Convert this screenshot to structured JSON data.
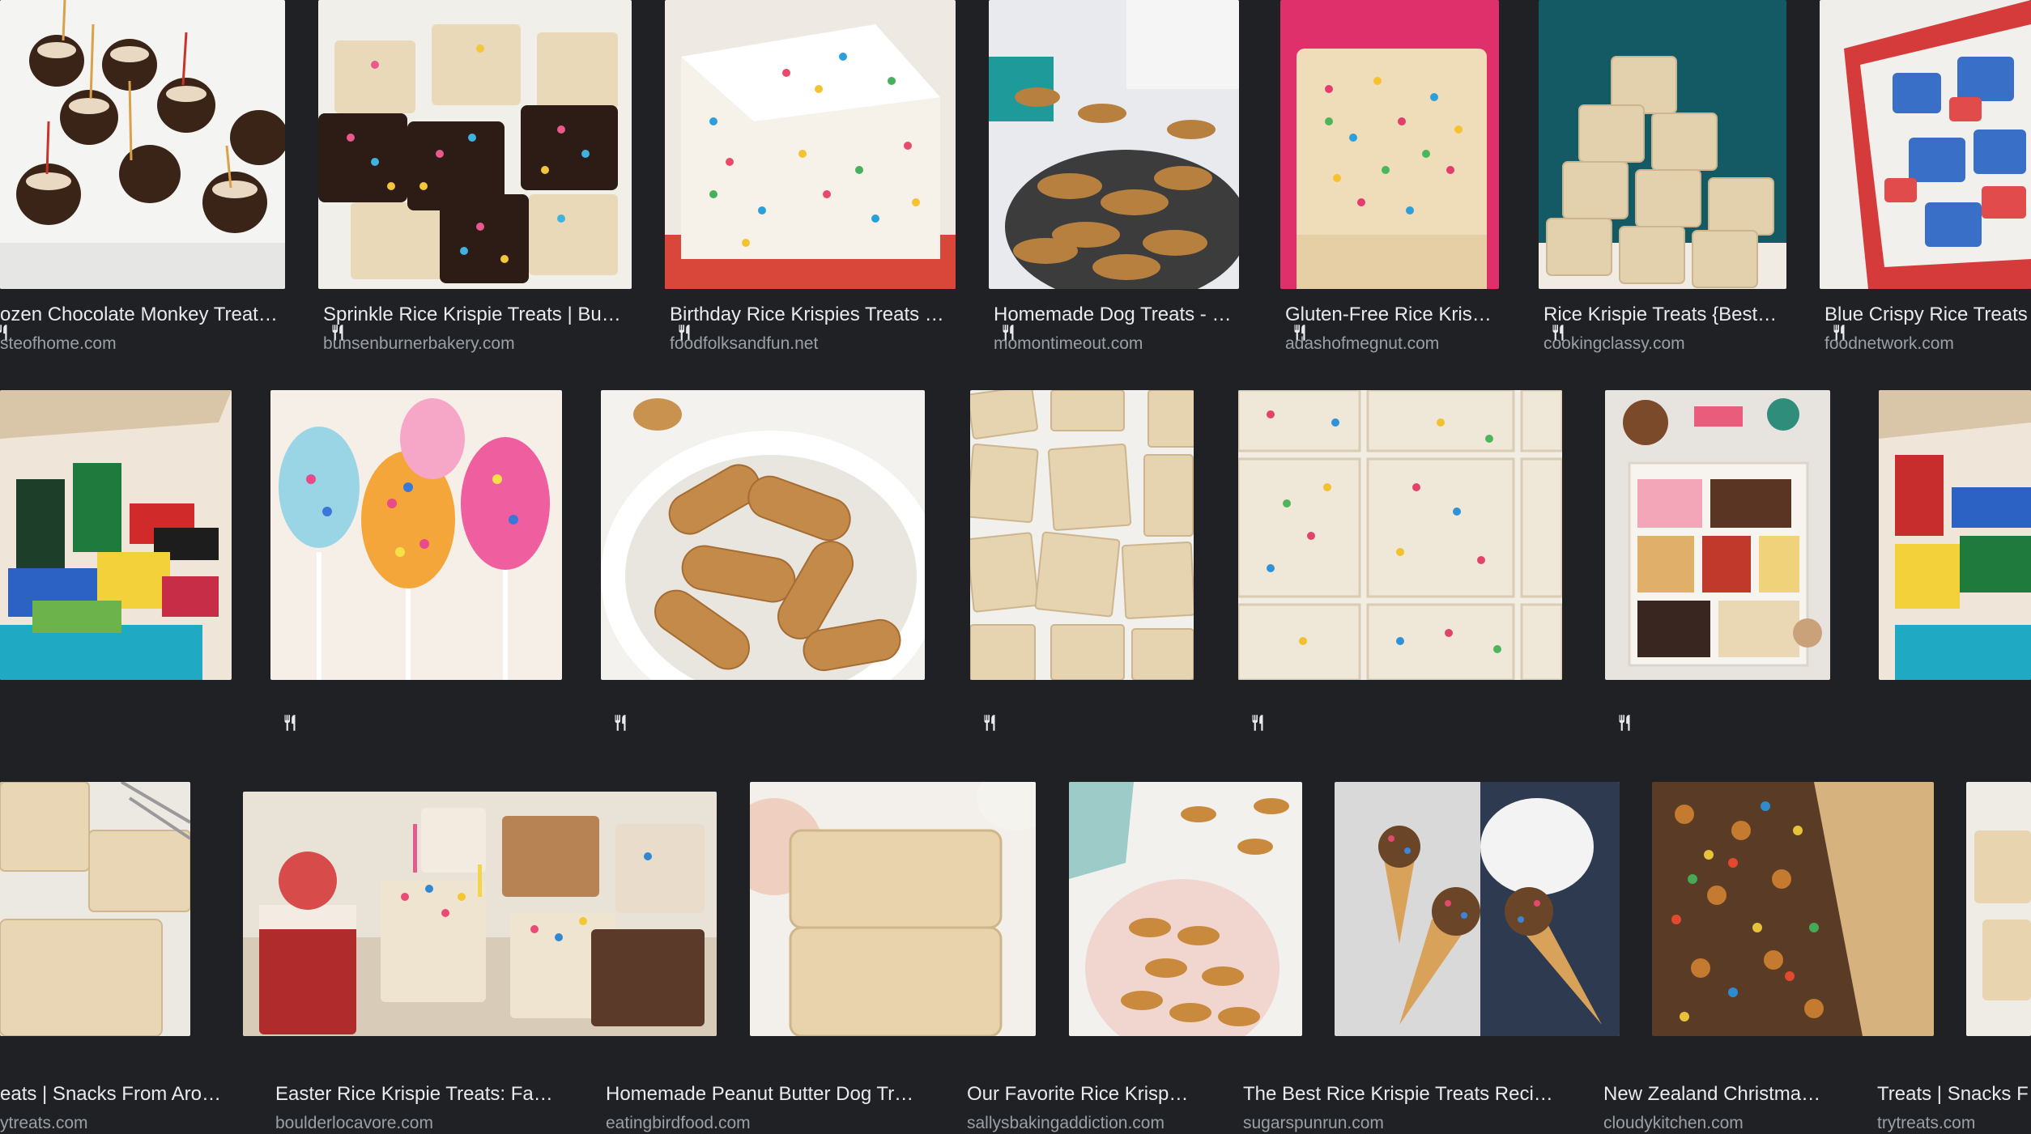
{
  "rows": [
    {
      "items": [
        {
          "title": "ozen Chocolate Monkey Treat…",
          "source": "steofhome.com",
          "icon": "utensils-icon"
        },
        {
          "title": "Sprinkle Rice Krispie Treats | Bu…",
          "source": "bunsenburnerbakery.com",
          "icon": "utensils-icon"
        },
        {
          "title": "Birthday Rice Krispies Treats …",
          "source": "foodfolksandfun.net",
          "icon": "utensils-icon"
        },
        {
          "title": "Homemade Dog Treats - …",
          "source": "momontimeout.com",
          "icon": "utensils-icon"
        },
        {
          "title": "Gluten-Free Rice Krispi…",
          "source": "adashofmegnut.com",
          "icon": "utensils-icon"
        },
        {
          "title": "Rice Krispie Treats {Best…",
          "source": "cookingclassy.com",
          "icon": "utensils-icon"
        },
        {
          "title": "Blue Crispy Rice Treats",
          "source": "foodnetwork.com",
          "icon": "utensils-icon"
        }
      ]
    },
    {
      "items": [
        {
          "title": "eats | Snacks From Aro…",
          "source": "ytreats.com",
          "icon": ""
        },
        {
          "title": "Easter Rice Krispie Treats: Fas…",
          "source": "boulderlocavore.com",
          "icon": "utensils-icon"
        },
        {
          "title": "Homemade Peanut Butter Dog Tr…",
          "source": "eatingbirdfood.com",
          "icon": "utensils-icon"
        },
        {
          "title": "Our Favorite Rice Krispi…",
          "source": "sallysbakingaddiction.com",
          "icon": "utensils-icon"
        },
        {
          "title": "The Best Rice Krispie Treats Reci…",
          "source": "sugarspunrun.com",
          "icon": "utensils-icon"
        },
        {
          "title": "New Zealand Christmas…",
          "source": "cloudykitchen.com",
          "icon": "utensils-icon"
        },
        {
          "title": "Treats | Snacks F",
          "source": "trytreats.com",
          "icon": ""
        }
      ]
    },
    {
      "items": [
        {
          "title": "",
          "source": "",
          "icon": ""
        },
        {
          "title": "",
          "source": "",
          "icon": ""
        },
        {
          "title": "",
          "source": "",
          "icon": ""
        },
        {
          "title": "",
          "source": "",
          "icon": ""
        },
        {
          "title": "",
          "source": "",
          "icon": ""
        },
        {
          "title": "",
          "source": "",
          "icon": ""
        },
        {
          "title": "",
          "source": "",
          "icon": ""
        }
      ]
    }
  ]
}
